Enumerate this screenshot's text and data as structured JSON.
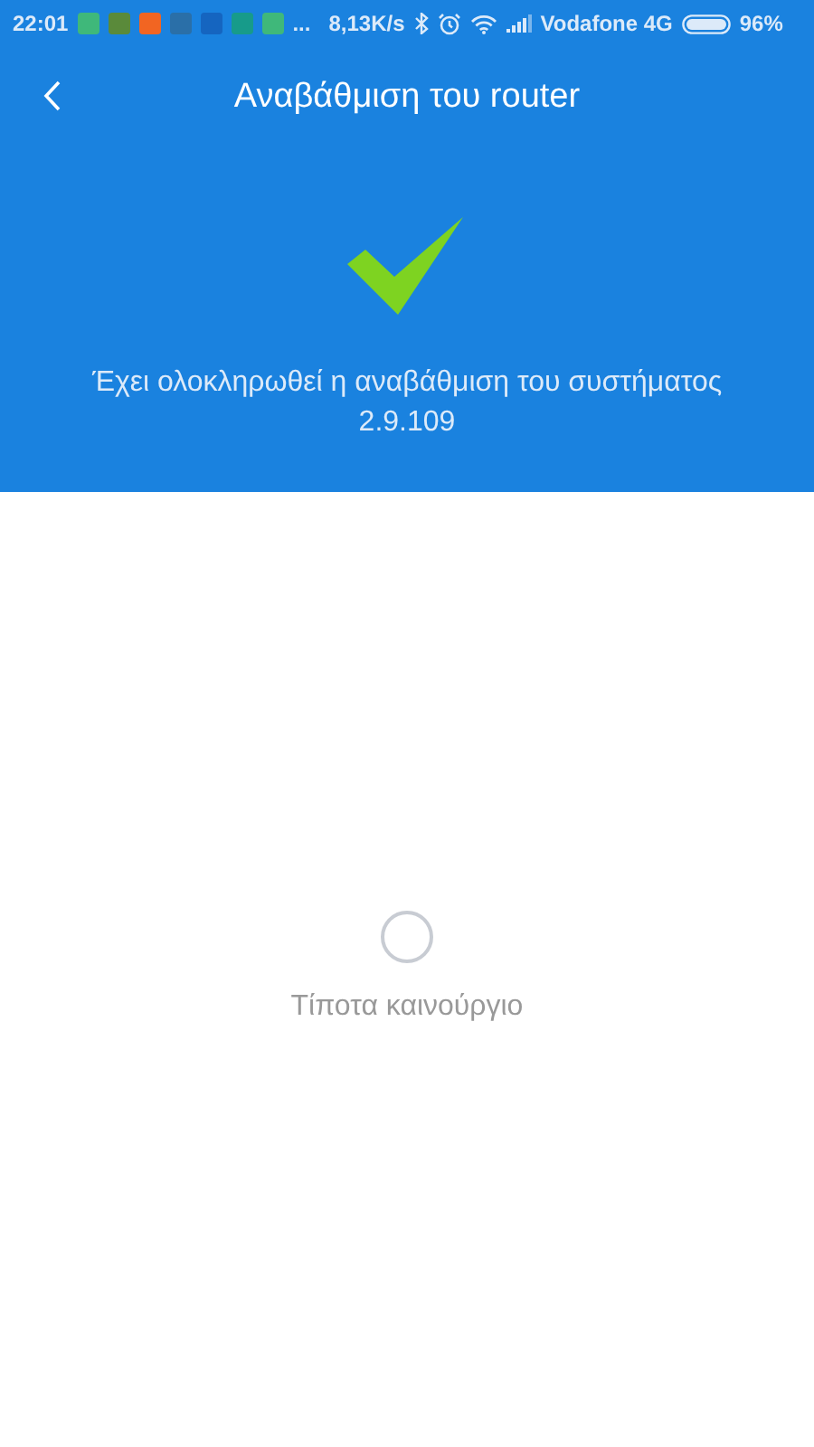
{
  "status_bar": {
    "time": "22:01",
    "app_icons": [
      {
        "color": "#3fb87a"
      },
      {
        "color": "#5a8a3a"
      },
      {
        "color": "#f26522"
      },
      {
        "color": "#2a6fa8"
      },
      {
        "color": "#1565c0"
      },
      {
        "color": "#179b8a"
      },
      {
        "color": "#3fb87a"
      }
    ],
    "more": "...",
    "speed": "8,13K/s",
    "carrier": "Vodafone 4G",
    "battery_percent": "96%"
  },
  "header": {
    "title": "Αναβάθμιση του router",
    "message": "Έχει ολοκληρωθεί η αναβάθμιση του συστήματος",
    "version": "2.9.109"
  },
  "empty_state": {
    "text": "Τίποτα καινούργιο"
  }
}
